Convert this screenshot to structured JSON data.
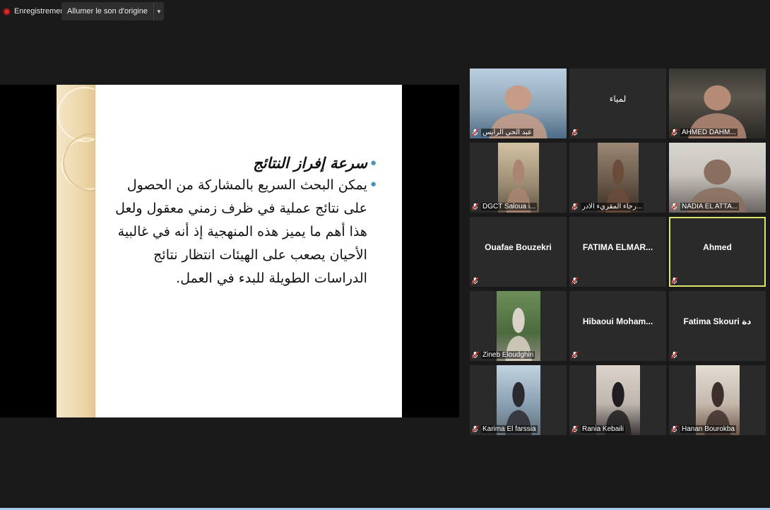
{
  "toolbar": {
    "recording_label": "Enregistrement",
    "original_sound_label": "Allumer le son d'origine"
  },
  "slide": {
    "title": "سرعة إفراز النتائج",
    "body": "يمكن البحث السريع بالمشاركة من الحصول على نتائج عملية في ظرف زمني معقول ولعل هذا أهم ما يميز هذه المنهجية إذ أنه في غالبية الأحيان يصعب على الهيئات انتظار نتائج الدراسات الطويلة للبدء في العمل."
  },
  "participants": [
    {
      "footer": "عبد الحي الرايس",
      "center": "",
      "video": true
    },
    {
      "footer": "",
      "center": "لمياء",
      "video": false
    },
    {
      "footer": "AHMED DAHM...",
      "center": "",
      "video": true
    },
    {
      "footer": "DGCT Saloua i...",
      "center": "",
      "video": true
    },
    {
      "footer": "رجاء المقريء الادر...",
      "center": "",
      "video": true
    },
    {
      "footer": "NADIA EL ATTA...",
      "center": "",
      "video": true
    },
    {
      "footer": "",
      "center": "Ouafae Bouzekri",
      "video": false
    },
    {
      "footer": "",
      "center": "FATIMA ELMAR...",
      "video": false
    },
    {
      "footer": "",
      "center": "Ahmed",
      "video": false,
      "active": true
    },
    {
      "footer": "Zineb Eloudghiri",
      "center": "",
      "video": true
    },
    {
      "footer": "",
      "center": "Hibaoui Moham...",
      "video": false
    },
    {
      "footer": "",
      "center": "Fatima Skouri دة",
      "video": false
    },
    {
      "footer": "Karima El farssia",
      "center": "",
      "video": true
    },
    {
      "footer": "Rania Kebaili",
      "center": "",
      "video": true
    },
    {
      "footer": "Hanan Bourokba",
      "center": "",
      "video": true
    }
  ],
  "colors": {
    "background": "#1a1a1a",
    "tile": "#2a2a2a",
    "active_speaker": "#dde46a",
    "muted": "#e0392f",
    "bullet": "#4b93b8"
  }
}
